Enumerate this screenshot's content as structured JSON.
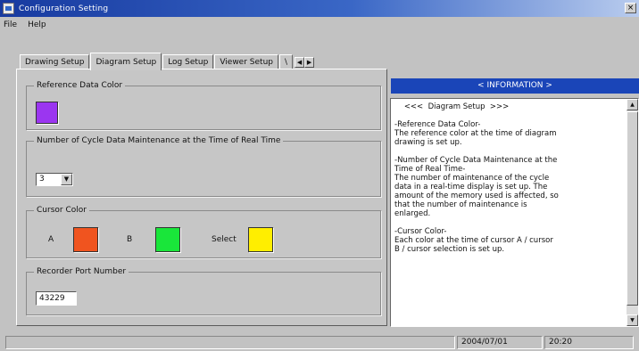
{
  "window": {
    "title": "Configuration Setting",
    "close_label": "×"
  },
  "menu": [
    {
      "label": "File"
    },
    {
      "label": "Help"
    }
  ],
  "tabs": [
    {
      "label": "Drawing Setup"
    },
    {
      "label": "Diagram Setup"
    },
    {
      "label": "Log Setup"
    },
    {
      "label": "Viewer Setup"
    },
    {
      "label": "\\"
    }
  ],
  "tab_scroll": {
    "left": "◀",
    "right": "▶"
  },
  "diagram_setup": {
    "reference_data_color": {
      "title": "Reference Data Color",
      "color": "#9b36f0"
    },
    "cycle_maintenance": {
      "title": "Number of Cycle Data Maintenance at the Time of Real Time",
      "value": "3",
      "arrow": "▼"
    },
    "cursor_color": {
      "title": "Cursor Color",
      "a_label": "A",
      "a_color": "#f0541f",
      "b_label": "B",
      "b_color": "#19e63a",
      "select_label": "Select",
      "select_color": "#ffee00"
    },
    "recorder_port": {
      "title": "Recorder Port Number",
      "value": "43229"
    }
  },
  "information": {
    "header": "< INFORMATION >",
    "text": "    <<<  Diagram Setup  >>>\n\n-Reference Data Color-\nThe reference color at the time of diagram\ndrawing is set up.\n\n-Number of Cycle Data Maintenance at the\nTime of Real Time-\nThe number of maintenance of the cycle\ndata in a real-time display is set up. The\namount of the memory used is affected, so\nthat the number of maintenance is\nenlarged.\n\n-Cursor Color-\nEach color at the time of cursor A / cursor\nB / cursor selection is set up.",
    "scroll_up": "▲",
    "scroll_down": "▼"
  },
  "status": {
    "date": "2004/07/01",
    "time": "20:20"
  }
}
